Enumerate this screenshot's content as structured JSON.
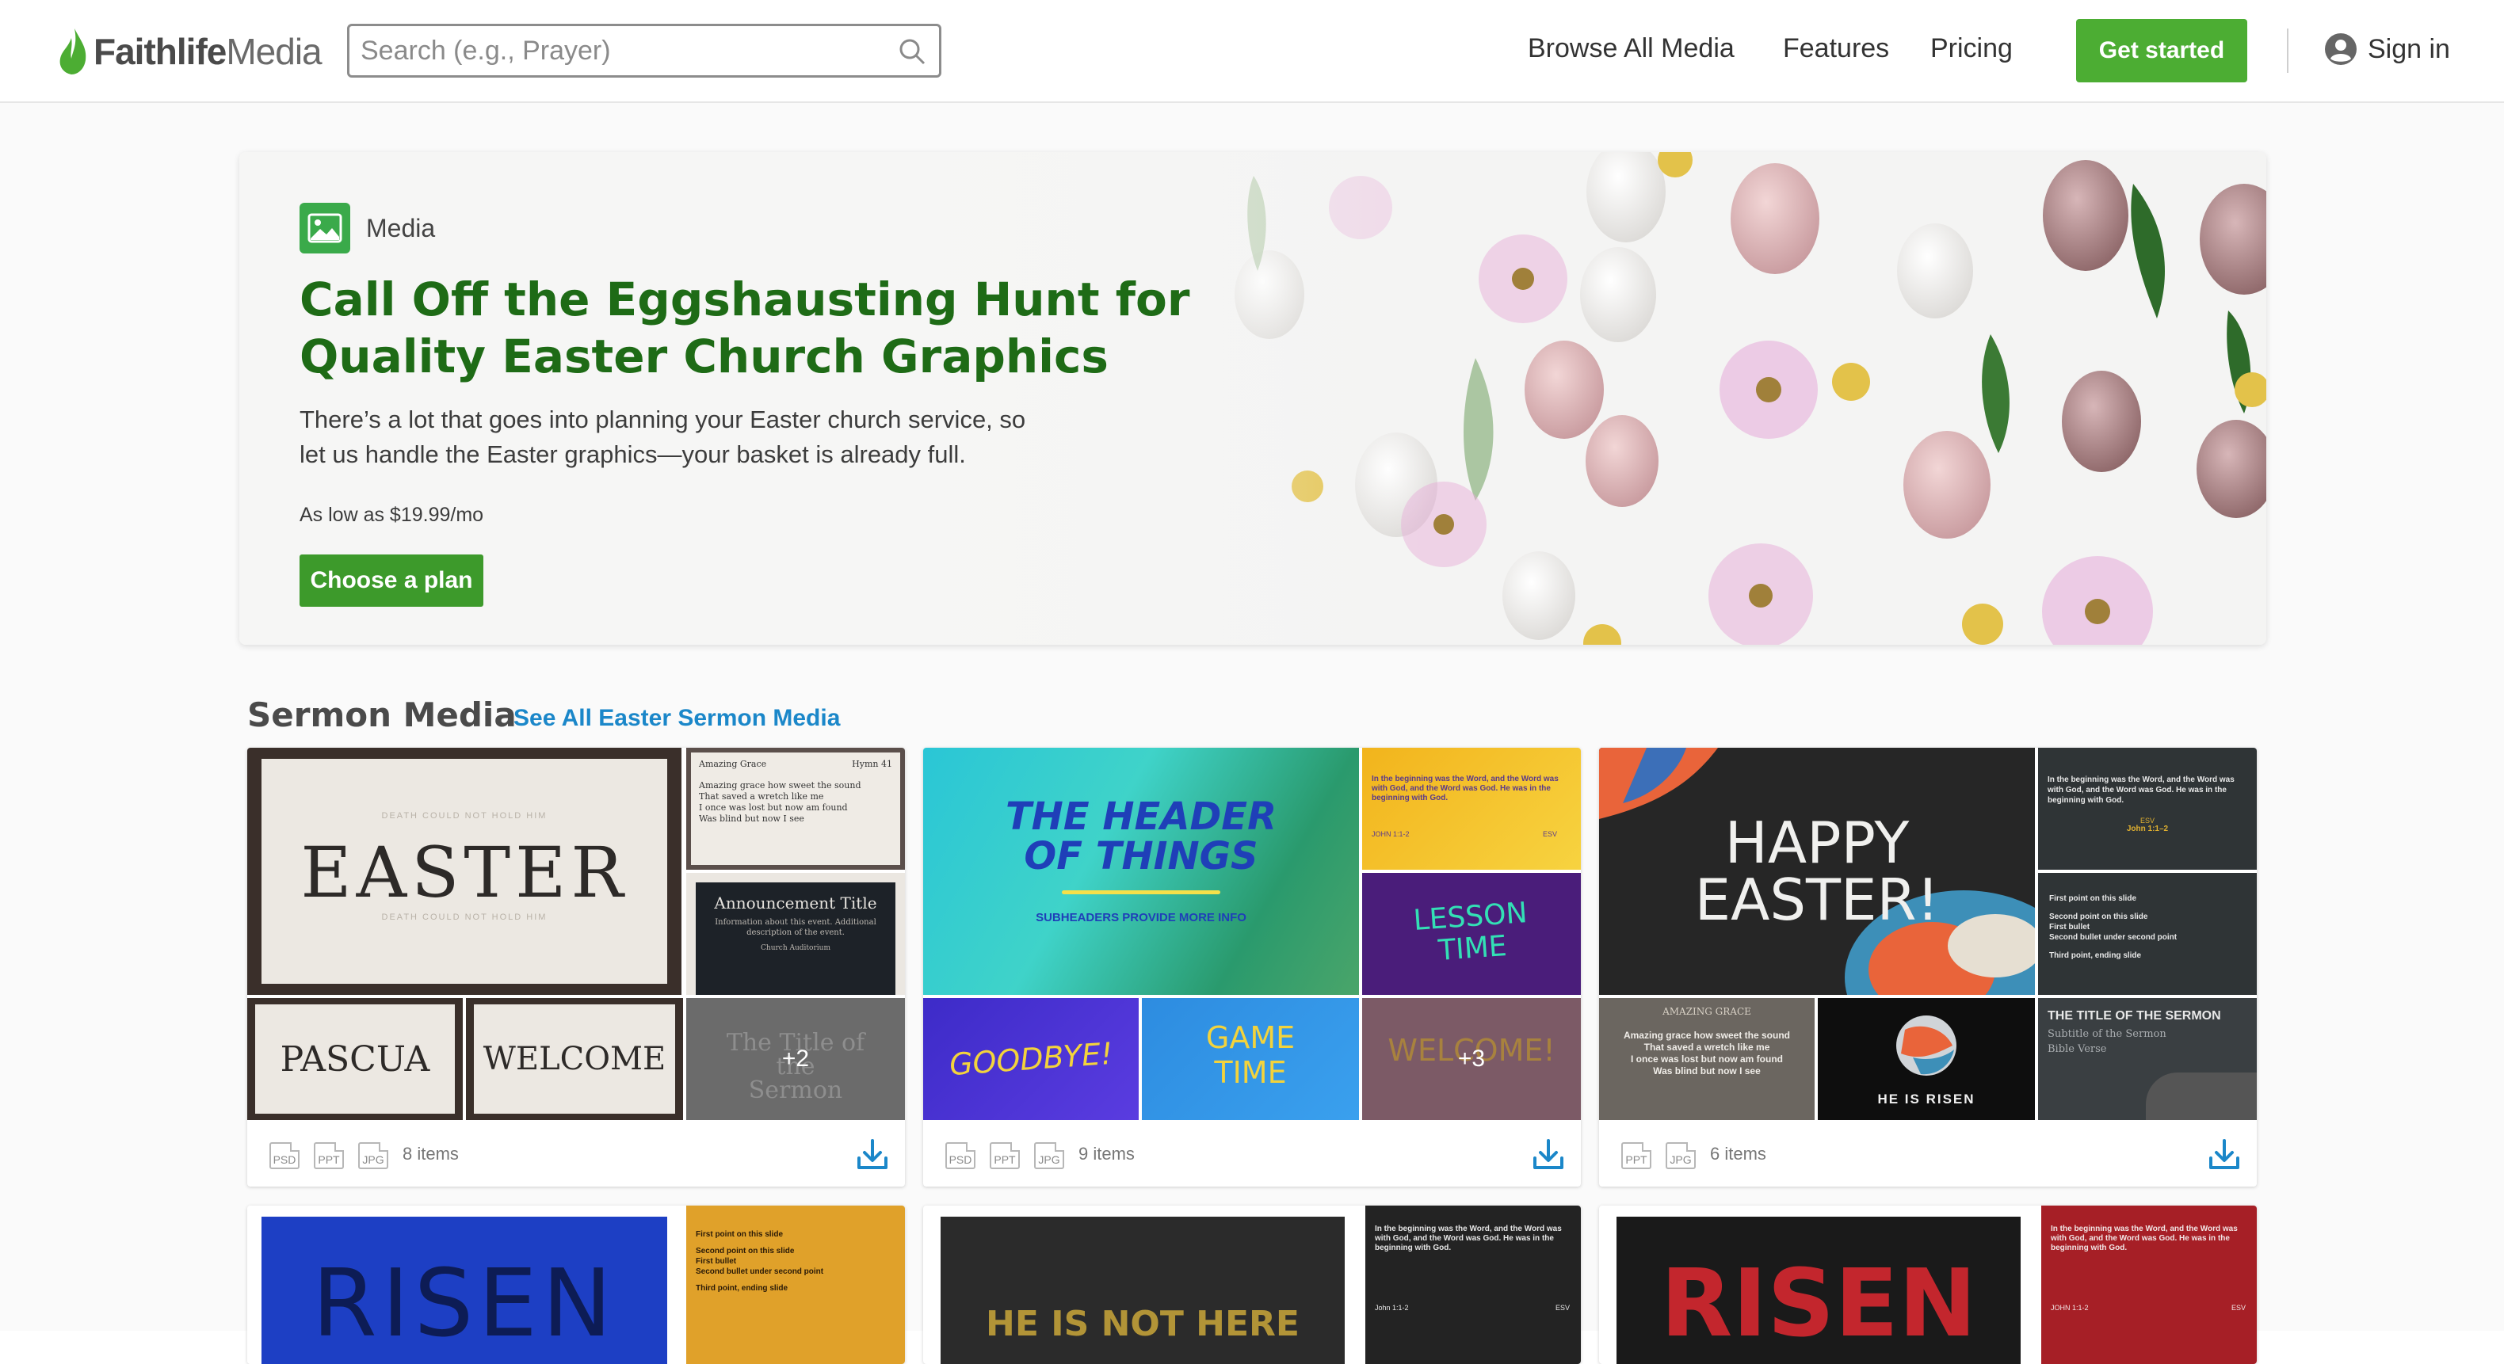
{
  "header": {
    "logo_bold": "Faithlife",
    "logo_light": "Media",
    "search_placeholder": "Search (e.g., Prayer)",
    "nav": [
      "Browse All Media",
      "Features",
      "Pricing"
    ],
    "get_started": "Get started",
    "sign_in": "Sign in"
  },
  "hero": {
    "badge": "Media",
    "title_line1": "Call Off the Eggshausting Hunt for",
    "title_line2": "Quality Easter Church Graphics",
    "desc_line1": "There’s a lot that goes into planning your Easter church service, so",
    "desc_line2": "let us handle the Easter graphics—your basket is already full.",
    "price": "As low as $19.99/mo",
    "cta": "Choose a plan"
  },
  "section": {
    "title": "Sermon Media",
    "link": "See All Easter Sermon Media"
  },
  "cards": [
    {
      "formats": [
        "PSD",
        "PPT",
        "JPG"
      ],
      "count": "8 items",
      "main_sub_top": "DEATH COULD NOT HOLD HIM",
      "main_title": "EASTER",
      "main_sub_bottom": "DEATH COULD NOT HOLD HIM",
      "hymn_title": "Amazing Grace",
      "hymn_num": "Hymn 41",
      "hymn_lines": [
        "Amazing grace how sweet the sound",
        "That saved a wretch like me",
        "I once was lost but now am found",
        "Was blind but now I see"
      ],
      "ann_title": "Announcement Title",
      "ann_desc": "Information about this event. Additional description of the event.",
      "ann_info": "Church Auditorium",
      "tile1": "PASCUA",
      "tile2": "WELCOME",
      "tile3": "The Title of the Sermon",
      "more": "+2"
    },
    {
      "formats": [
        "PSD",
        "PPT",
        "JPG"
      ],
      "count": "9 items",
      "main_title1": "THE HEADER",
      "main_title2": "OF THINGS",
      "main_sub": "SUBHEADERS PROVIDE MORE INFO",
      "verse_text": "In the beginning was the Word, and the Word was with God, and the Word was God. He was in the beginning with God.",
      "verse_ref": "JOHN 1:1-2",
      "verse_ver": "ESV",
      "lesson1": "LESSON",
      "lesson2": "TIME",
      "tile1": "GOODBYE!",
      "tile2a": "GAME",
      "tile2b": "TIME",
      "tile3": "WELCOME!",
      "more": "+3"
    },
    {
      "formats": [
        "PPT",
        "JPG"
      ],
      "count": "6 items",
      "main_title1": "HAPPY",
      "main_title2": "EASTER!",
      "verse_text": "In the beginning was the Word, and the Word was with God, and the Word was God. He was in the beginning with God.",
      "verse_ver": "ESV",
      "verse_ref": "John 1:1–2",
      "points": [
        "First point on this slide",
        "Second point on this slide",
        "First bullet",
        "Second bullet under second point",
        "Third point, ending slide"
      ],
      "hymn_title": "AMAZING GRACE",
      "hymn_lines": [
        "Amazing grace how sweet the sound",
        "That saved a wretch like me",
        "I once was lost but now am found",
        "Was blind but now I see"
      ],
      "risen": "HE IS RISEN",
      "sermon_title": "THE TITLE OF THE SERMON",
      "sermon_sub": "Subtitle of the Sermon",
      "sermon_verse": "Bible Verse"
    }
  ],
  "row2": {
    "c1_main": "RISEN",
    "c1_points": [
      "First point on this slide",
      "Second point on this slide",
      "First bullet",
      "Second bullet under second point",
      "Third point, ending slide"
    ],
    "c2_main": "HE IS NOT HERE",
    "c2_verse": "In the beginning was the Word, and the Word was with God, and the Word was God. He was in the beginning with God.",
    "c2_ref": "John 1:1-2",
    "c2_ver": "ESV",
    "c3_main": "RISEN",
    "c3_verse": "In the beginning was the Word, and the Word was with God, and the Word was God. He was in the beginning with God.",
    "c3_ref": "JOHN 1:1-2",
    "c3_ver": "ESV"
  },
  "colors": {
    "brand_green": "#4cad33",
    "title_green": "#1e6b16",
    "link_blue": "#1b87c9"
  }
}
